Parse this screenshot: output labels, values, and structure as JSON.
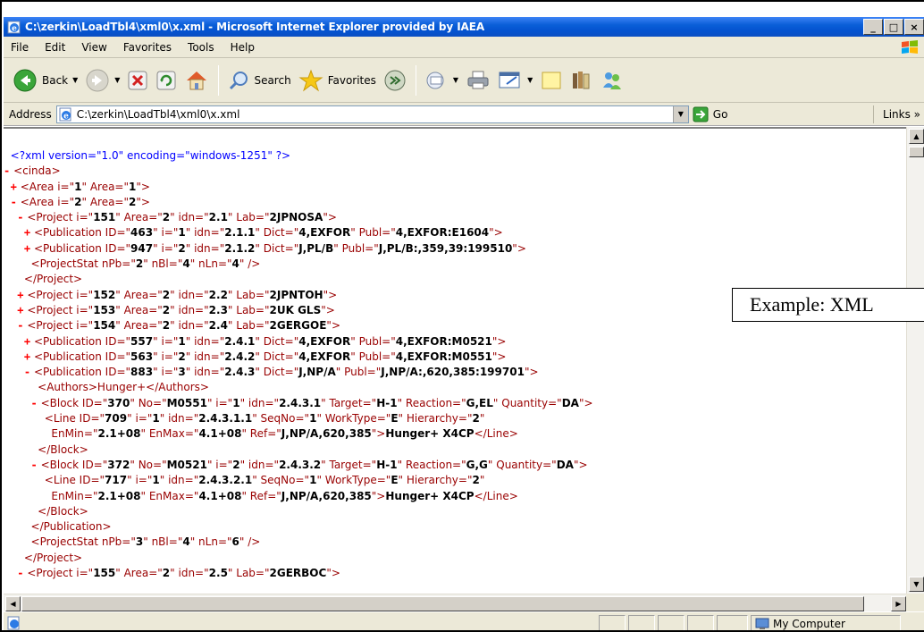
{
  "window": {
    "title": "C:\\zerkin\\LoadTbl4\\xml0\\x.xml - Microsoft Internet Explorer provided by IAEA",
    "controls": {
      "minimize": "_",
      "maximize": "□",
      "close": "×"
    }
  },
  "menu": {
    "items": [
      "File",
      "Edit",
      "View",
      "Favorites",
      "Tools",
      "Help"
    ]
  },
  "toolbar": {
    "back_label": "Back",
    "search_label": "Search",
    "favorites_label": "Favorites"
  },
  "address": {
    "label": "Address",
    "url": "C:\\zerkin\\LoadTbl4\\xml0\\x.xml",
    "go_label": "Go",
    "links_label": "Links »"
  },
  "document": {
    "lines": [
      "  <?xml version=\"1.0\" encoding=\"windows-1251\" ?>",
      "- <cinda>",
      "  + <Area i=\"1\" Area=\"1\">",
      "  - <Area i=\"2\" Area=\"2\">",
      "    - <Project i=\"151\" Area=\"2\" idn=\"2.1\" Lab=\"2JPNOSA\">",
      "      + <Publication ID=\"463\" i=\"1\" idn=\"2.1.1\" Dict=\"4,EXFOR\" Publ=\"4,EXFOR:E1604\">",
      "      + <Publication ID=\"947\" i=\"2\" idn=\"2.1.2\" Dict=\"J,PL/B\" Publ=\"J,PL/B:,359,39:199510\">",
      "        <ProjectStat nPb=\"2\" nBl=\"4\" nLn=\"4\" />",
      "      </Project>",
      "    + <Project i=\"152\" Area=\"2\" idn=\"2.2\" Lab=\"2JPNTOH\">",
      "    + <Project i=\"153\" Area=\"2\" idn=\"2.3\" Lab=\"2UK GLS\">",
      "    - <Project i=\"154\" Area=\"2\" idn=\"2.4\" Lab=\"2GERGOE\">",
      "      + <Publication ID=\"557\" i=\"1\" idn=\"2.4.1\" Dict=\"4,EXFOR\" Publ=\"4,EXFOR:M0521\">",
      "      + <Publication ID=\"563\" i=\"2\" idn=\"2.4.2\" Dict=\"4,EXFOR\" Publ=\"4,EXFOR:M0551\">",
      "      - <Publication ID=\"883\" i=\"3\" idn=\"2.4.3\" Dict=\"J,NP/A\" Publ=\"J,NP/A:,620,385:199701\">",
      "          <Authors>Hunger+</Authors>",
      "        - <Block ID=\"370\" No=\"M0551\" i=\"1\" idn=\"2.4.3.1\" Target=\"H-1\" Reaction=\"G,EL\" Quantity=\"DA\">",
      "            <Line ID=\"709\" i=\"1\" idn=\"2.4.3.1.1\" SeqNo=\"1\" WorkType=\"E\" Hierarchy=\"2\"",
      "              EnMin=\"2.1+08\" EnMax=\"4.1+08\" Ref=\"J,NP/A,620,385\">Hunger+ X4CP</Line>",
      "          </Block>",
      "        - <Block ID=\"372\" No=\"M0521\" i=\"2\" idn=\"2.4.3.2\" Target=\"H-1\" Reaction=\"G,G\" Quantity=\"DA\">",
      "            <Line ID=\"717\" i=\"1\" idn=\"2.4.3.2.1\" SeqNo=\"1\" WorkType=\"E\" Hierarchy=\"2\"",
      "              EnMin=\"2.1+08\" EnMax=\"4.1+08\" Ref=\"J,NP/A,620,385\">Hunger+ X4CP</Line>",
      "          </Block>",
      "        </Publication>",
      "        <ProjectStat nPb=\"3\" nBl=\"4\" nLn=\"6\" />",
      "      </Project>",
      "    - <Project i=\"155\" Area=\"2\" idn=\"2.5\" Lab=\"2GERBOC\">"
    ]
  },
  "status": {
    "zone": "My Computer"
  },
  "overlay": {
    "example_label": "Example: XML"
  },
  "colors": {
    "titlebar": "#0453d0",
    "chrome": "#ece9d8",
    "tag": "#990000",
    "pi": "#0000ff",
    "marker": "#ff0000"
  }
}
